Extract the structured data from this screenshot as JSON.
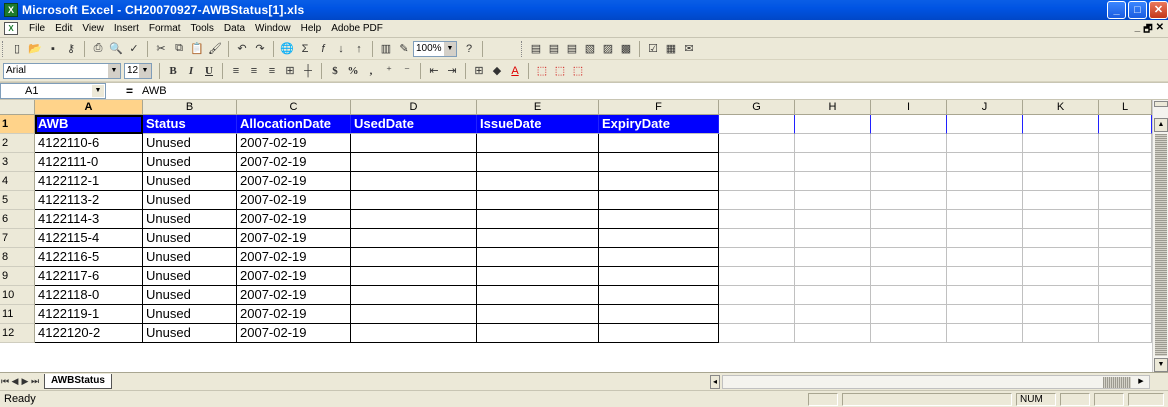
{
  "window": {
    "title": "Microsoft Excel - CH20070927-AWBStatus[1].xls",
    "app_icon": "excel-icon",
    "buttons": [
      "_",
      "□",
      "✕"
    ]
  },
  "menu": {
    "items": [
      "File",
      "Edit",
      "View",
      "Insert",
      "Format",
      "Tools",
      "Data",
      "Window",
      "Help",
      "Adobe PDF"
    ],
    "doc_controls": [
      "_",
      "🗗",
      "✕"
    ]
  },
  "toolbar": {
    "zoom": "100%",
    "font_name": "Arial",
    "font_size": "12",
    "bold": "B",
    "italic": "I",
    "underline": "U",
    "currency": "$",
    "percent": "%",
    "comma": ","
  },
  "formula_bar": {
    "name_box": "A1",
    "eq": "=",
    "value": "AWB"
  },
  "columns": [
    "A",
    "B",
    "C",
    "D",
    "E",
    "F",
    "G",
    "H",
    "I",
    "J",
    "K",
    "L"
  ],
  "header_row": {
    "row_num": "1",
    "cells": [
      "AWB",
      "Status",
      "AllocationDate",
      "UsedDate",
      "IssueDate",
      "ExpiryDate"
    ]
  },
  "rows": [
    {
      "num": "2",
      "awb": "4122110-6",
      "status": "Unused",
      "alloc": "2007-02-19"
    },
    {
      "num": "3",
      "awb": "4122111-0",
      "status": "Unused",
      "alloc": "2007-02-19"
    },
    {
      "num": "4",
      "awb": "4122112-1",
      "status": "Unused",
      "alloc": "2007-02-19"
    },
    {
      "num": "5",
      "awb": "4122113-2",
      "status": "Unused",
      "alloc": "2007-02-19"
    },
    {
      "num": "6",
      "awb": "4122114-3",
      "status": "Unused",
      "alloc": "2007-02-19"
    },
    {
      "num": "7",
      "awb": "4122115-4",
      "status": "Unused",
      "alloc": "2007-02-19"
    },
    {
      "num": "8",
      "awb": "4122116-5",
      "status": "Unused",
      "alloc": "2007-02-19"
    },
    {
      "num": "9",
      "awb": "4122117-6",
      "status": "Unused",
      "alloc": "2007-02-19"
    },
    {
      "num": "10",
      "awb": "4122118-0",
      "status": "Unused",
      "alloc": "2007-02-19"
    },
    {
      "num": "11",
      "awb": "4122119-1",
      "status": "Unused",
      "alloc": "2007-02-19"
    },
    {
      "num": "12",
      "awb": "4122120-2",
      "status": "Unused",
      "alloc": "2007-02-19"
    }
  ],
  "sheet_tabs": [
    "AWBStatus"
  ],
  "status_bar": {
    "text": "Ready",
    "num": "NUM"
  },
  "colors": {
    "header_fill": "#0000ff",
    "title_bar": "#0054e3"
  }
}
